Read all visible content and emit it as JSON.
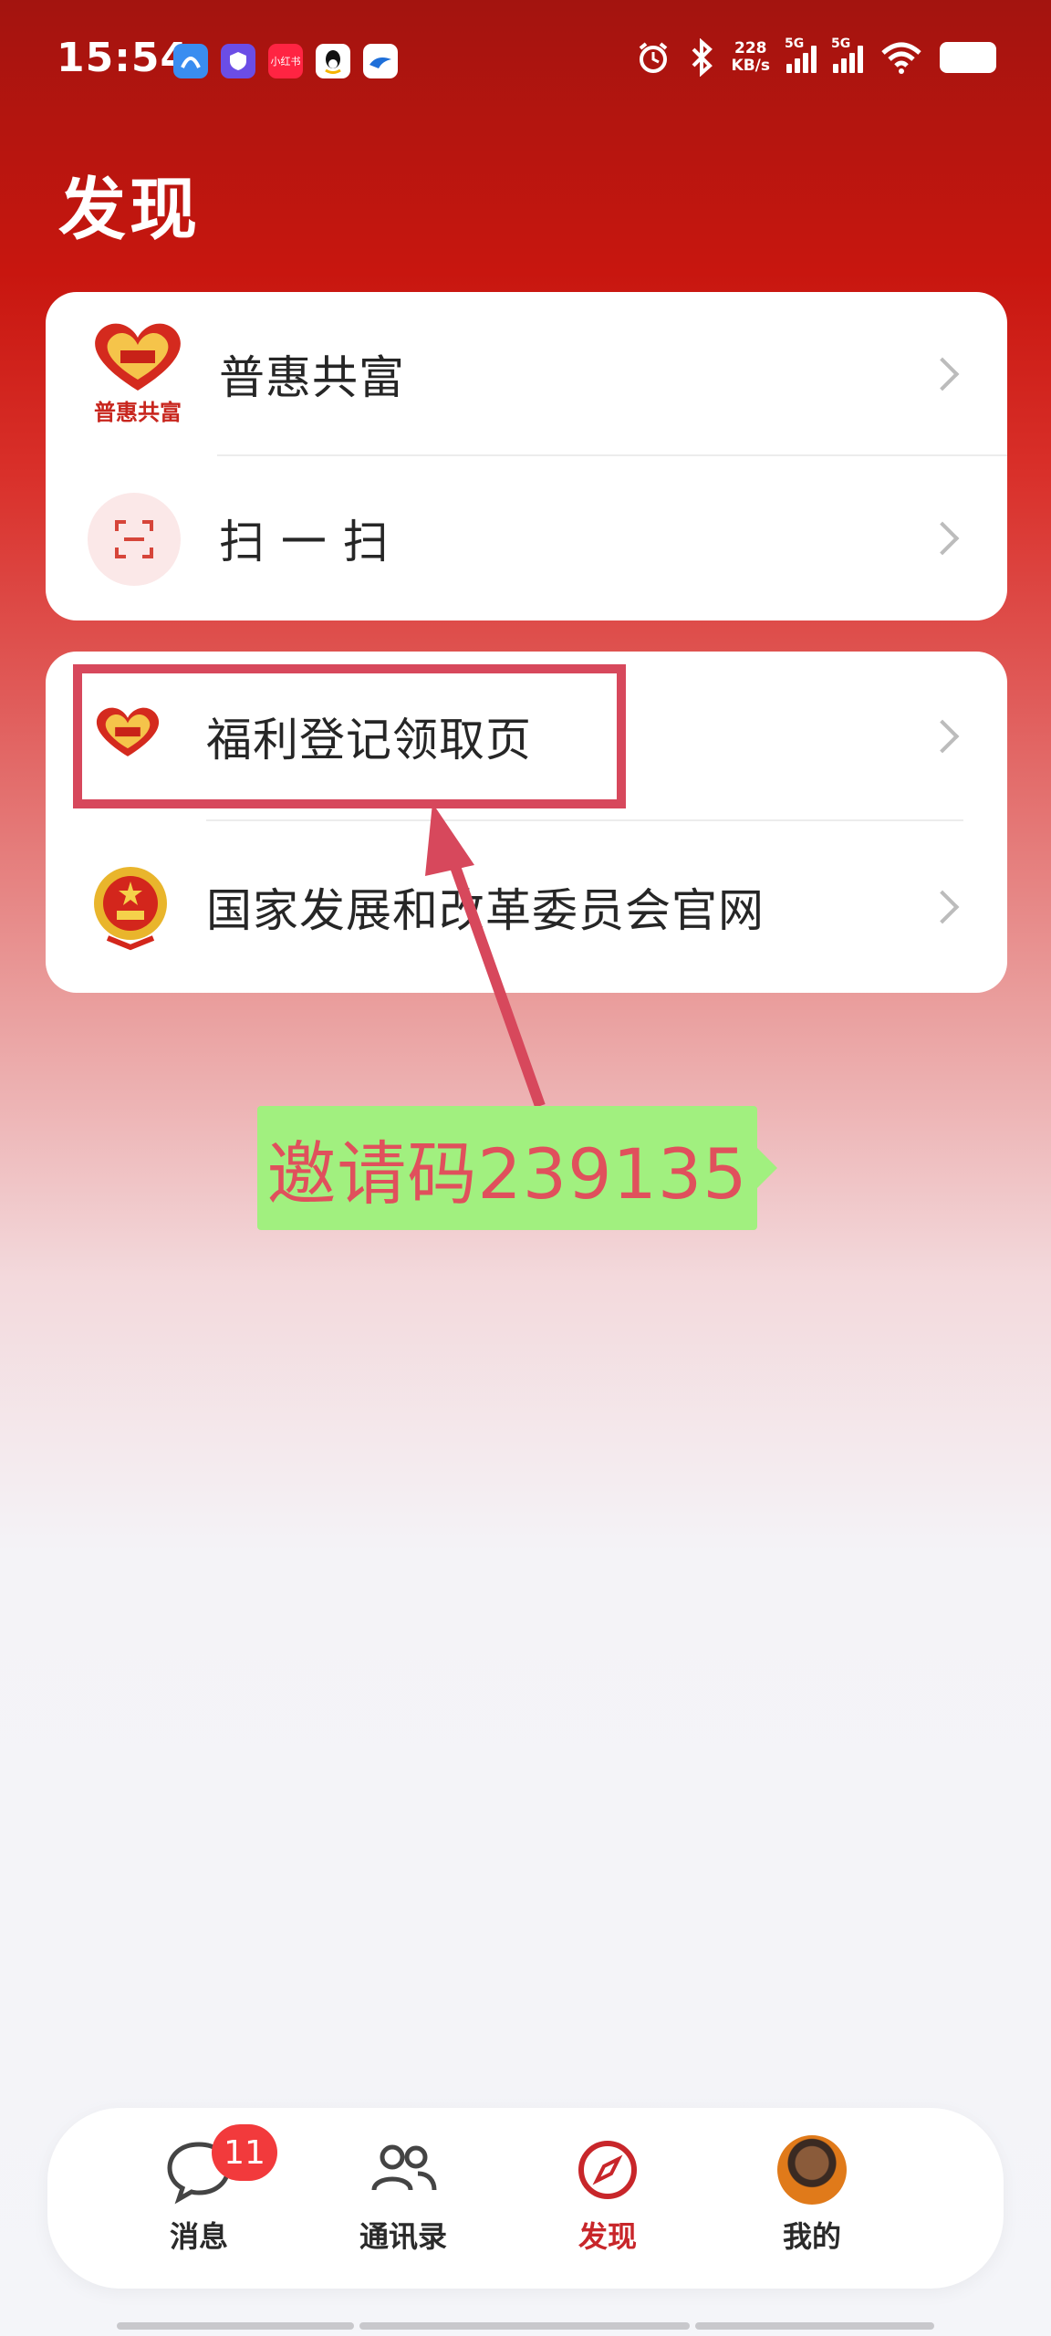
{
  "status_bar": {
    "time": "15:54",
    "net_speed_value": "228",
    "net_speed_unit": "KB/s",
    "signal1_label": "5G",
    "signal2_label": "5G",
    "notification_icons": [
      "blue-app-icon",
      "shield-app-icon",
      "xiaohongshu-icon",
      "qq-icon",
      "bird-app-icon"
    ],
    "xiaohongshu_label": "小红书"
  },
  "page": {
    "title": "发现"
  },
  "card1": {
    "items": [
      {
        "label": "普惠共富",
        "logo_text": "普惠共富",
        "icon": "heart-logo-icon"
      },
      {
        "label": "扫 一 扫",
        "icon": "scan-icon"
      }
    ]
  },
  "card2": {
    "items": [
      {
        "label": "福利登记领取页",
        "icon": "heart-logo-icon"
      },
      {
        "label": "国家发展和改革委员会官网",
        "icon": "national-emblem-icon"
      }
    ]
  },
  "annotation": {
    "invite_text": "邀请码239135"
  },
  "bottom_nav": {
    "items": [
      {
        "label": "消息",
        "icon": "chat-bubble-icon",
        "badge": "11"
      },
      {
        "label": "通讯录",
        "icon": "contacts-icon"
      },
      {
        "label": "发现",
        "icon": "compass-icon",
        "active": true
      },
      {
        "label": "我的",
        "icon": "avatar-icon"
      }
    ]
  },
  "colors": {
    "accent": "#c8262a",
    "highlight_box": "#d7485c",
    "invite_bg": "#a1f07f",
    "badge": "#f23a3c"
  }
}
